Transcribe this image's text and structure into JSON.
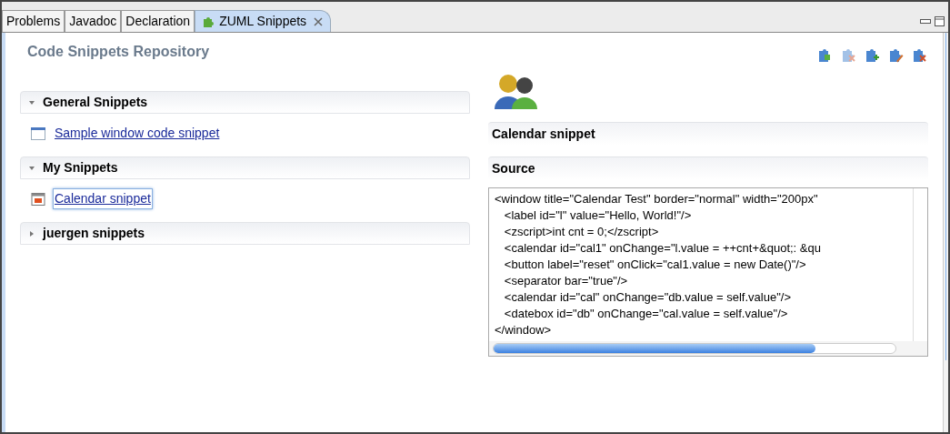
{
  "tabs": [
    {
      "label": "Problems",
      "selected": false
    },
    {
      "label": "Javadoc",
      "selected": false
    },
    {
      "label": "Declaration",
      "selected": false
    },
    {
      "label": "ZUML Snippets",
      "selected": true
    }
  ],
  "view": {
    "title": "Code Snippets Repository"
  },
  "sections": [
    {
      "title": "General Snippets",
      "expanded": true,
      "items": [
        {
          "label": "Sample window code snippet",
          "kind": "window",
          "selected": false
        }
      ]
    },
    {
      "title": "My Snippets",
      "expanded": true,
      "items": [
        {
          "label": "Calendar snippet",
          "kind": "calendar",
          "selected": true
        }
      ]
    },
    {
      "title": "juergen snippets",
      "expanded": false
    }
  ],
  "detail": {
    "name_header": "Calendar snippet",
    "source_header": "Source",
    "code_lines": [
      "<window title=\"Calendar Test\" border=\"normal\" width=\"200px\"",
      "   <label id=\"l\" value=\"Hello, World!\"/>",
      "   <zscript>int cnt = 0;</zscript>",
      "   <calendar id=\"cal1\" onChange=\"l.value = ++cnt+&quot;: &qu",
      "   <button label=\"reset\" onClick=\"cal1.value = new Date()\"/>",
      "   <separator bar=\"true\"/>",
      "   <calendar id=\"cal\" onChange=\"db.value = self.value\"/>",
      "   <datebox id=\"db\" onChange=\"cal.value = self.value\"/>",
      "</window>"
    ]
  }
}
